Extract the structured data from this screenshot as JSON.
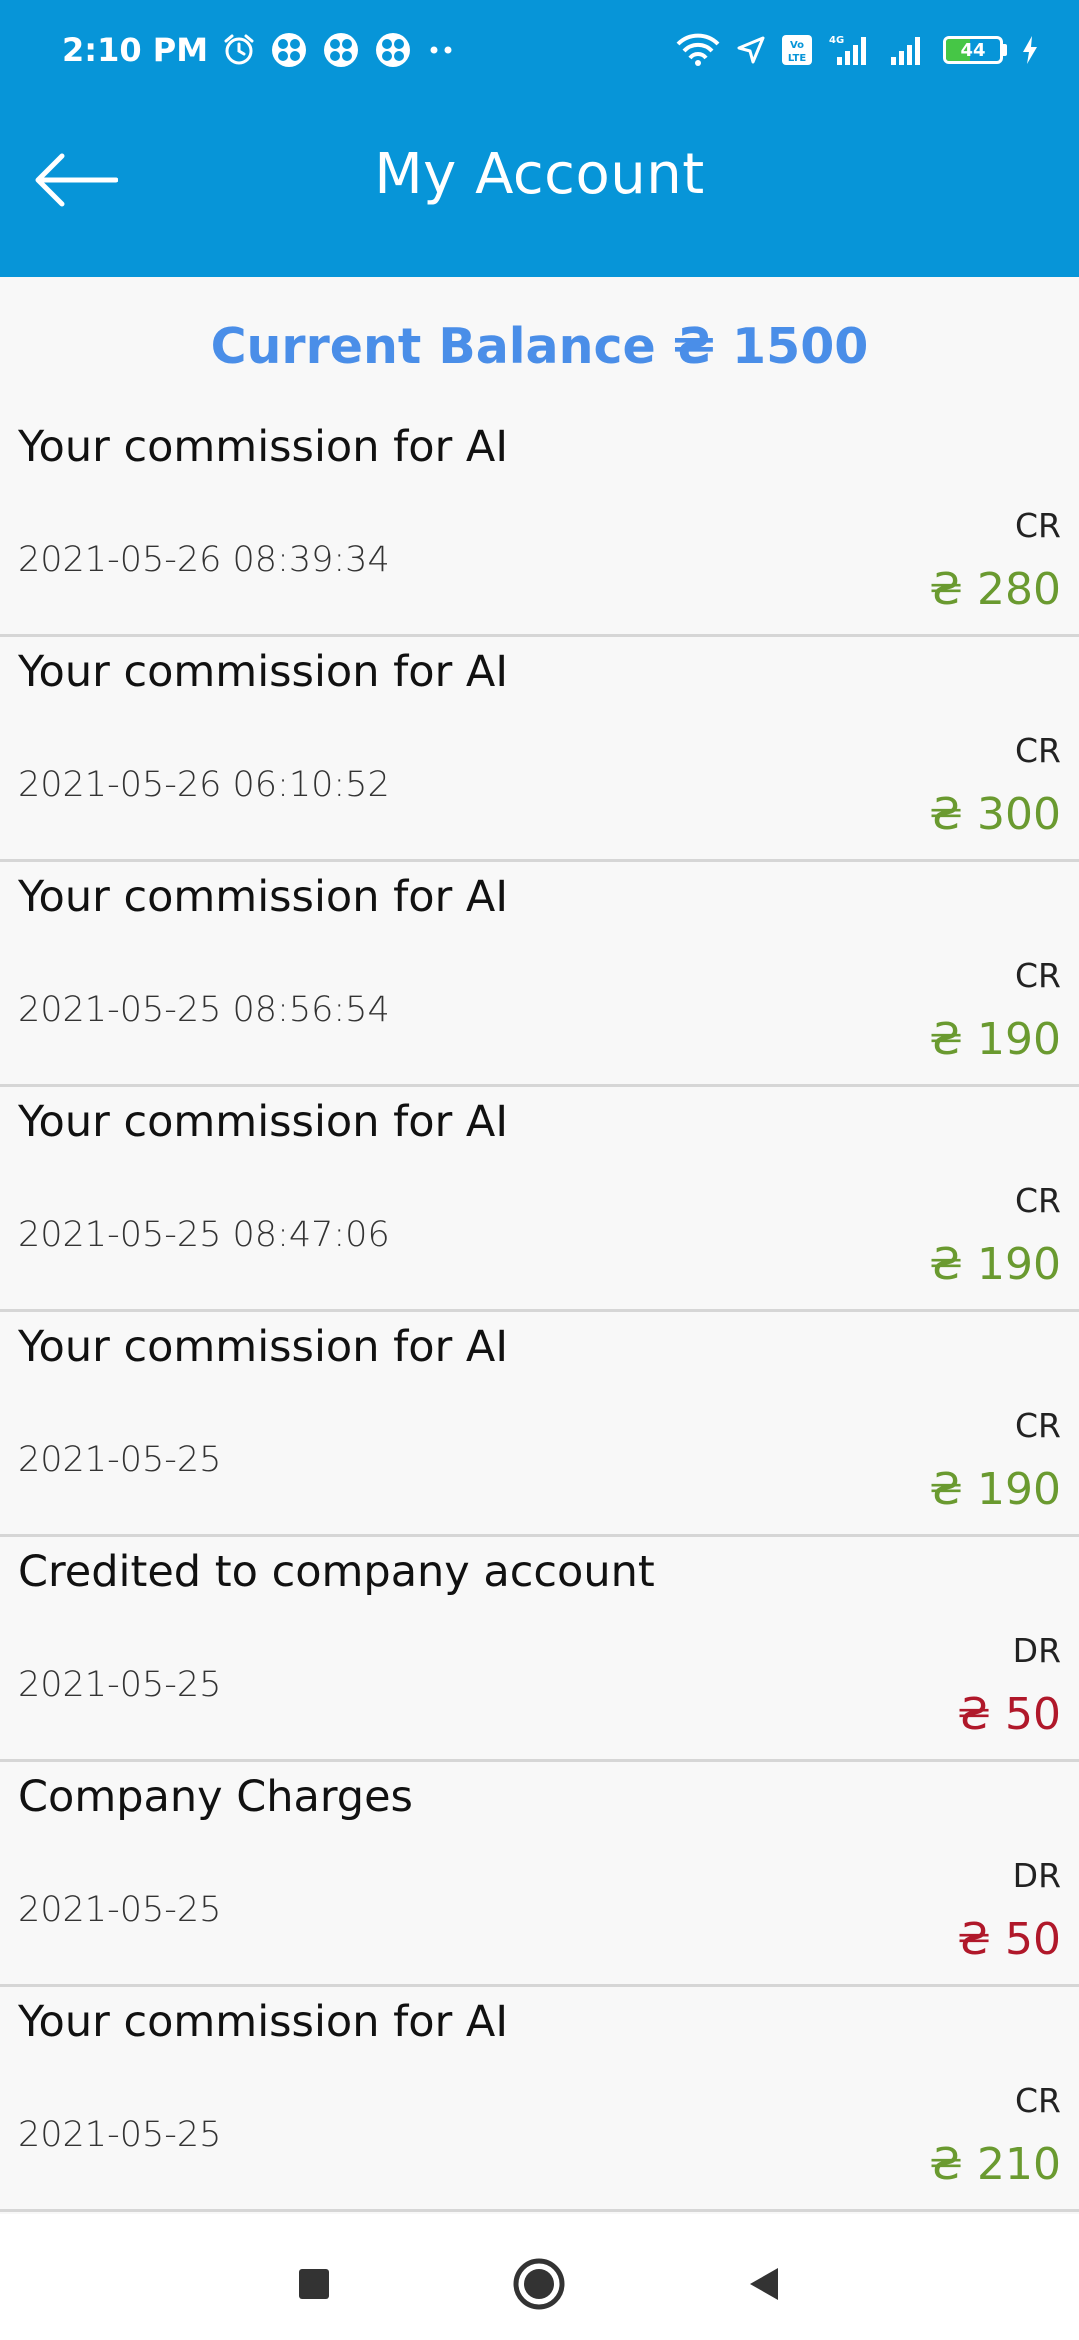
{
  "status_bar": {
    "time": "2:10 PM",
    "battery": "44",
    "battery_level": 0.44,
    "icons": [
      "alarm-icon",
      "app-icon",
      "app-icon",
      "app-icon",
      "more-dots-icon",
      "wifi-icon",
      "location-icon",
      "volte-icon",
      "signal-4g-icon",
      "signal-icon",
      "battery-icon",
      "charging-icon"
    ]
  },
  "header": {
    "title": "My Account"
  },
  "balance": {
    "text": "Current Balance ₴ 1500"
  },
  "colors": {
    "appbar": "#0795d8",
    "balance": "#4a8ee8",
    "credit": "#6a9a30",
    "debit": "#b0182a"
  },
  "transactions": [
    {
      "title": "Your commission for AI",
      "date": "2021-05-26 08:39:34",
      "type": "CR",
      "amount": "₴ 280"
    },
    {
      "title": "Your commission for AI",
      "date": "2021-05-26 06:10:52",
      "type": "CR",
      "amount": "₴ 300"
    },
    {
      "title": "Your commission for AI",
      "date": "2021-05-25 08:56:54",
      "type": "CR",
      "amount": "₴ 190"
    },
    {
      "title": "Your commission for AI",
      "date": "2021-05-25 08:47:06",
      "type": "CR",
      "amount": "₴ 190"
    },
    {
      "title": "Your commission for AI",
      "date": "2021-05-25",
      "type": "CR",
      "amount": "₴ 190"
    },
    {
      "title": "Credited to company account",
      "date": "2021-05-25",
      "type": "DR",
      "amount": "₴ 50"
    },
    {
      "title": "Company Charges",
      "date": "2021-05-25",
      "type": "DR",
      "amount": "₴ 50"
    },
    {
      "title": "Your commission for AI",
      "date": "2021-05-25",
      "type": "CR",
      "amount": "₴ 210"
    }
  ],
  "nav": {
    "icons": [
      "recents-icon",
      "home-icon",
      "back-icon"
    ]
  }
}
